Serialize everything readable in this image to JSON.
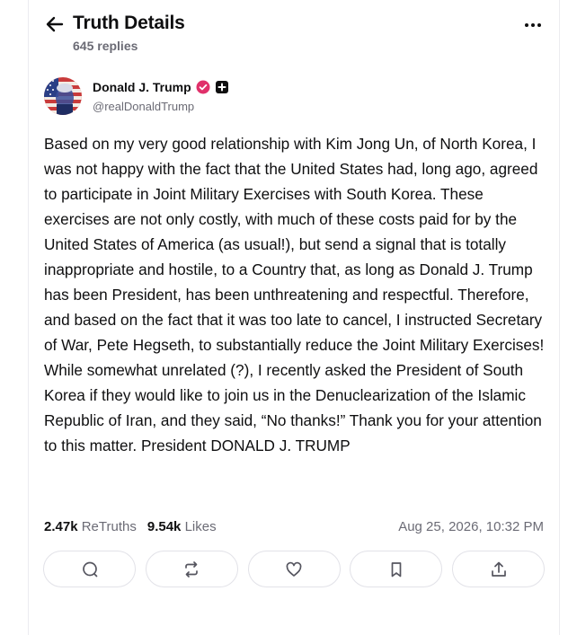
{
  "header": {
    "title": "Truth Details",
    "subtitle": "645 replies"
  },
  "author": {
    "name": "Donald J. Trump",
    "handle": "@realDonaldTrump"
  },
  "post": {
    "text": "Based on my very good relationship with Kim Jong Un, of North Korea, I was not happy with the fact that the United States had, long ago, agreed to participate in Joint Military Exercises with South Korea. These exercises are not only costly, with much of these costs paid for by the United States of America (as usual!), but send a signal that is totally inappropriate and hostile, to a Country that, as long as Donald J. Trump has been President, has been unthreatening and respectful. Therefore, and based on the fact that it was too late to cancel, I instructed Secretary of War, Pete Hegseth, to substantially reduce the Joint Military Exercises! While somewhat unrelated (?), I recently asked the President of South Korea if they would like to join us in the Denuclearization of the Islamic Republic of Iran, and they said, “No thanks!” Thank you for your attention to this matter. President DONALD J. TRUMP",
    "retruths_count": "2.47k",
    "retruths_label": "ReTruths",
    "likes_count": "9.54k",
    "likes_label": "Likes",
    "timestamp": "Aug 25, 2026, 10:32 PM"
  },
  "icons": {
    "back": "arrow-left-icon",
    "more": "more-horizontal-icon",
    "verified": "verified-badge-icon",
    "plus": "plus-badge-icon",
    "reply": "reply-icon",
    "retruth": "retruth-icon",
    "like": "heart-icon",
    "bookmark": "bookmark-icon",
    "share": "share-icon"
  },
  "colors": {
    "verified_badge": "#e0306a",
    "muted_text": "#6b6b75",
    "border": "#e2e2e8"
  }
}
